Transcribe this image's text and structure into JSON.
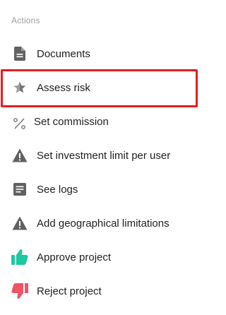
{
  "section": {
    "title": "Actions"
  },
  "menu": {
    "items": [
      {
        "label": "Documents",
        "icon": "document-icon"
      },
      {
        "label": "Assess risk",
        "icon": "star-icon"
      },
      {
        "label": "Set commission",
        "icon": "percent-icon"
      },
      {
        "label": "Set investment limit per user",
        "icon": "warning-icon"
      },
      {
        "label": "See logs",
        "icon": "logs-icon"
      },
      {
        "label": "Add geographical limitations",
        "icon": "warning-icon"
      },
      {
        "label": "Approve project",
        "icon": "thumbs-up-icon"
      },
      {
        "label": "Reject project",
        "icon": "thumbs-down-icon"
      }
    ]
  },
  "colors": {
    "icon_gray": "#616161",
    "approve_green": "#1ec8a0",
    "reject_red": "#ef5366",
    "highlight_red": "#e41e1e",
    "section_title_gray": "#9e9e9e"
  }
}
